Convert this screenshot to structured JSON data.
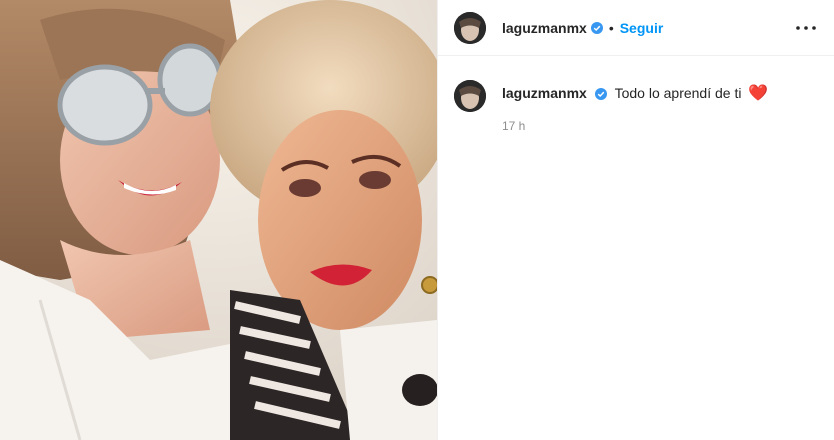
{
  "post": {
    "photo_alt": "Foto",
    "author": "laguzmanmx",
    "follow_label": "Seguir",
    "separator": "•",
    "caption": "Todo lo aprendí de ti",
    "caption_emoji": "❤️",
    "time": "17 h"
  },
  "colors": {
    "accent": "#0095f6",
    "verified": "#3897f0",
    "heart": "#ed1c24",
    "muted": "#8e8e8e"
  },
  "icons": {
    "verified": "verified-badge-icon",
    "more": "more-options-icon"
  }
}
